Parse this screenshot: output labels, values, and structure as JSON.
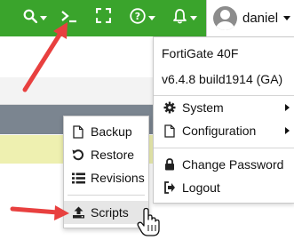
{
  "topbar": {
    "accent_color": "#3aa42c",
    "buttons": [
      {
        "icon": "search-icon"
      },
      {
        "icon": "cli-console-icon"
      },
      {
        "icon": "fullscreen-icon"
      },
      {
        "icon": "help-icon"
      },
      {
        "icon": "notifications-bell-icon"
      }
    ]
  },
  "user": {
    "name": "daniel",
    "avatar_icon": "user-avatar-icon"
  },
  "user_menu": {
    "device_model": "FortiGate 40F",
    "firmware_version": "v6.4.8 build1914 (GA)",
    "items": [
      {
        "label": "System",
        "icon": "gear-icon"
      },
      {
        "label": "Configuration",
        "icon": "file-icon"
      },
      {
        "label": "Change Password",
        "icon": "lock-icon"
      },
      {
        "label": "Logout",
        "icon": "logout-icon"
      }
    ]
  },
  "configuration_submenu": {
    "items": [
      {
        "label": "Backup",
        "icon": "file-icon"
      },
      {
        "label": "Restore",
        "icon": "restore-icon"
      },
      {
        "label": "Revisions",
        "icon": "list-icon"
      },
      {
        "label": "Scripts",
        "icon": "upload-icon"
      }
    ]
  },
  "annotations": {
    "arrow_color": "#e8403f"
  }
}
